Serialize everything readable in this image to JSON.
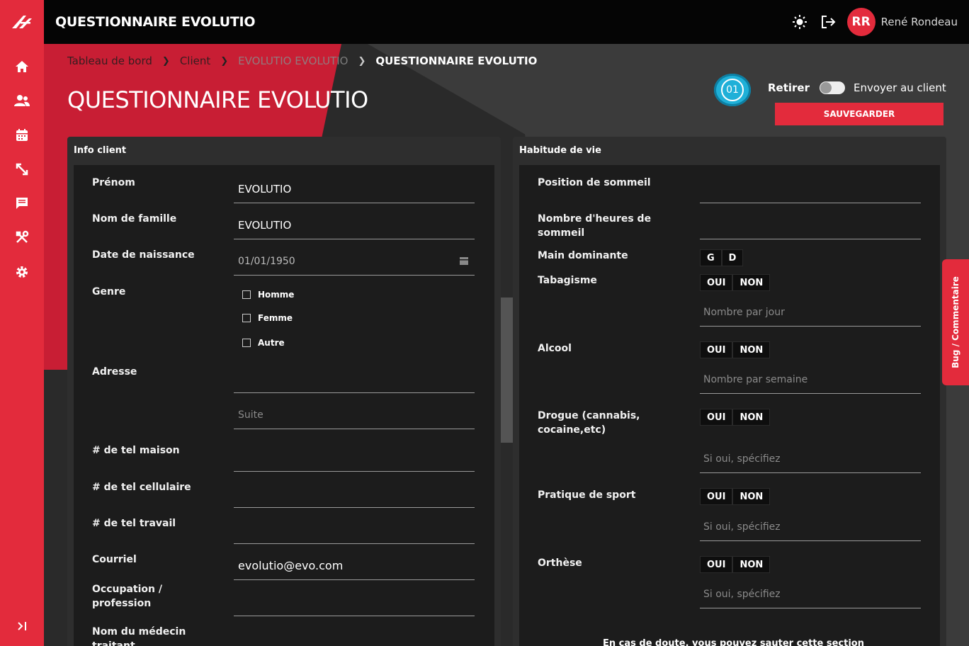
{
  "app": {
    "title": "QUESTIONNAIRE EVOLUTIO"
  },
  "user": {
    "initials": "RR",
    "name": "René Rondeau"
  },
  "breadcrumb": [
    "Tableau de bord",
    "Client",
    "EVOLUTIO EVOLUTIO",
    "QUESTIONNAIRE EVOLUTIO"
  ],
  "page": {
    "title": "QUESTIONNAIRE EVOLUTIO"
  },
  "controls": {
    "step": "01",
    "toggle_left": "Retirer",
    "toggle_right": "Envoyer au client",
    "save": "SAUVEGARDER"
  },
  "info_client": {
    "title": "Info client",
    "prenom_label": "Prénom",
    "prenom": "EVOLUTIO",
    "nom_label": "Nom de famille",
    "nom": "EVOLUTIO",
    "naissance_label": "Date de naissance",
    "naissance": "01/01/1950",
    "genre_label": "Genre",
    "genre_options": [
      "Homme",
      "Femme",
      "Autre"
    ],
    "adresse_label": "Adresse",
    "adresse": "",
    "suite_placeholder": "Suite",
    "tel_maison_label": "# de tel maison",
    "tel_cell_label": "# de tel cellulaire",
    "tel_travail_label": "# de tel travail",
    "courriel_label": "Courriel",
    "courriel": "evolutio@evo.com",
    "occupation_label": "Occupation / profession",
    "medecin_label": "Nom du médecin traitant"
  },
  "habitude": {
    "title": "Habitude de vie",
    "sommeil_pos_label": "Position de sommeil",
    "sommeil_heures_label": "Nombre d'heures de sommeil",
    "main_label": "Main dominante",
    "main_options": [
      "G",
      "D"
    ],
    "tabac_label": "Tabagisme",
    "tabac_placeholder": "Nombre par jour",
    "alcool_label": "Alcool",
    "alcool_placeholder": "Nombre par semaine",
    "drogue_label": "Drogue (cannabis, cocaine,etc)",
    "drogue_placeholder": "Si oui, spécifiez",
    "sport_label": "Pratique de sport",
    "sport_placeholder": "Si oui, spécifiez",
    "orthese_label": "Orthèse",
    "orthese_placeholder": "Si oui, spécifiez",
    "yes": "OUI",
    "no": "NON",
    "note": "En cas de doute, vous pouvez sauter cette section"
  },
  "bug_tab": "Bug / Commentaire"
}
